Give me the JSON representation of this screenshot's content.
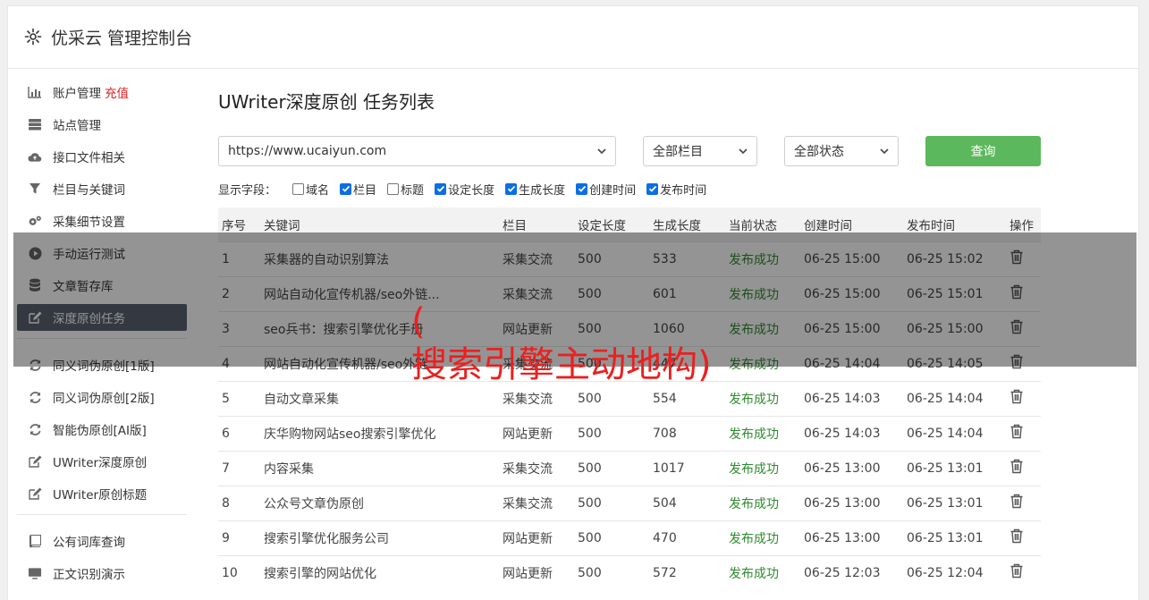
{
  "header": {
    "title": "优采云 管理控制台"
  },
  "sidebar": {
    "group1": [
      {
        "label": "账户管理",
        "extra": "充值",
        "icon": "bar-chart-icon"
      },
      {
        "label": "站点管理",
        "icon": "server-icon"
      },
      {
        "label": "接口文件相关",
        "icon": "cloud-upload-icon"
      },
      {
        "label": "栏目与关键词",
        "icon": "filter-icon"
      },
      {
        "label": "采集细节设置",
        "icon": "gears-icon"
      },
      {
        "label": "手动运行测试",
        "icon": "play-circle-icon"
      },
      {
        "label": "文章暂存库",
        "icon": "database-icon"
      },
      {
        "label": "深度原创任务",
        "icon": "edit-icon",
        "active": true
      }
    ],
    "group2": [
      {
        "label": "同义词伪原创[1版]",
        "icon": "refresh-icon"
      },
      {
        "label": "同义词伪原创[2版]",
        "icon": "refresh-icon"
      },
      {
        "label": "智能伪原创[AI版]",
        "icon": "refresh-icon"
      },
      {
        "label": "UWriter深度原创",
        "icon": "edit-icon"
      },
      {
        "label": "UWriter原创标题",
        "icon": "edit-icon"
      }
    ],
    "group3": [
      {
        "label": "公有词库查询",
        "icon": "book-icon"
      },
      {
        "label": "正文识别演示",
        "icon": "monitor-icon"
      }
    ]
  },
  "main": {
    "title": "UWriter深度原创 任务列表",
    "site_select": "https://www.ucaiyun.com",
    "column_select": "全部栏目",
    "status_select": "全部状态",
    "query_label": "查询",
    "fields_label": "显示字段：",
    "fields": [
      {
        "label": "域名",
        "checked": false
      },
      {
        "label": "栏目",
        "checked": true
      },
      {
        "label": "标题",
        "checked": false
      },
      {
        "label": "设定长度",
        "checked": true
      },
      {
        "label": "生成长度",
        "checked": true
      },
      {
        "label": "创建时间",
        "checked": true
      },
      {
        "label": "发布时间",
        "checked": true
      }
    ]
  },
  "table": {
    "headers": [
      "序号",
      "关键词",
      "栏目",
      "设定长度",
      "生成长度",
      "当前状态",
      "创建时间",
      "发布时间",
      "操作"
    ],
    "rows": [
      [
        "1",
        "采集器的自动识别算法",
        "采集交流",
        "500",
        "533",
        "发布成功",
        "06-25 15:00",
        "06-25 15:02"
      ],
      [
        "2",
        "网站自动化宣传机器/seo外链...",
        "采集交流",
        "500",
        "601",
        "发布成功",
        "06-25 15:00",
        "06-25 15:01"
      ],
      [
        "3",
        "seo兵书：搜索引擎优化手册",
        "网站更新",
        "500",
        "1060",
        "发布成功",
        "06-25 15:00",
        "06-25 15:00"
      ],
      [
        "4",
        "网站自动化宣传机器/seo外链...",
        "采集交流",
        "500",
        "447",
        "发布成功",
        "06-25 14:04",
        "06-25 14:05"
      ],
      [
        "5",
        "自动文章采集",
        "采集交流",
        "500",
        "554",
        "发布成功",
        "06-25 14:03",
        "06-25 14:04"
      ],
      [
        "6",
        "庆华购物网站seo搜索引擎优化",
        "网站更新",
        "500",
        "708",
        "发布成功",
        "06-25 14:03",
        "06-25 14:04"
      ],
      [
        "7",
        "内容采集",
        "采集交流",
        "500",
        "1017",
        "发布成功",
        "06-25 13:00",
        "06-25 13:01"
      ],
      [
        "8",
        "公众号文章伪原创",
        "采集交流",
        "500",
        "504",
        "发布成功",
        "06-25 13:00",
        "06-25 13:01"
      ],
      [
        "9",
        "搜索引擎优化服务公司",
        "网站更新",
        "500",
        "470",
        "发布成功",
        "06-25 13:00",
        "06-25 13:01"
      ],
      [
        "10",
        "搜索引擎的网站优化",
        "网站更新",
        "500",
        "572",
        "发布成功",
        "06-25 12:03",
        "06-25 12:04"
      ]
    ]
  },
  "overlay": {
    "line1": "(",
    "line2": "搜索引擎主动地构)"
  }
}
